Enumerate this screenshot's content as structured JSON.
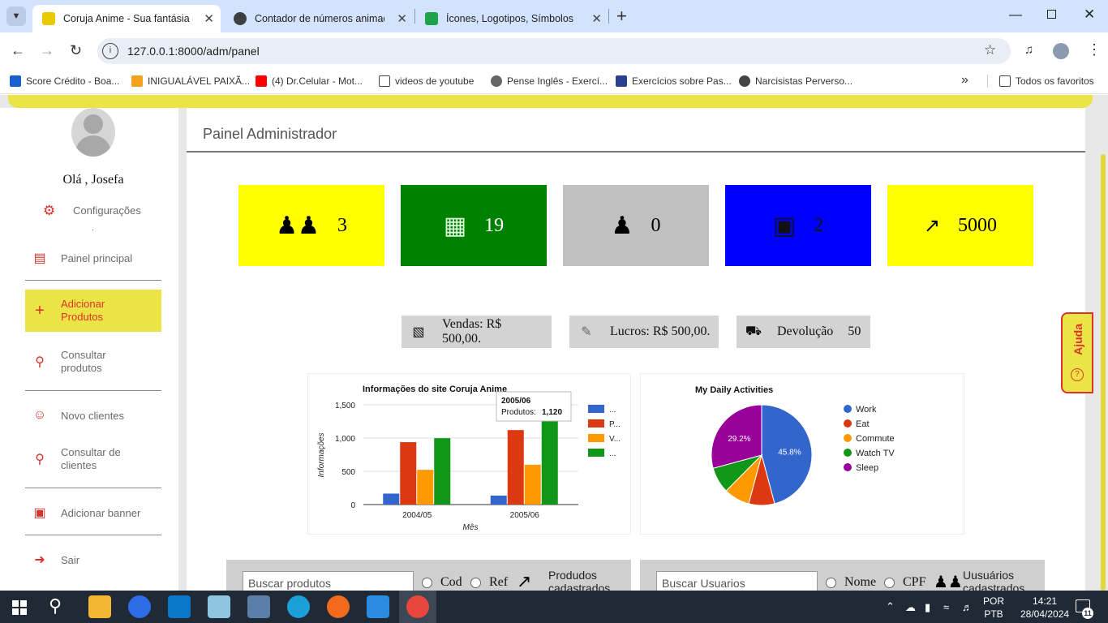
{
  "browser": {
    "tabs": [
      {
        "title": "Coruja Anime - Sua fantásia ide",
        "active": true
      },
      {
        "title": "Contador de números animado",
        "active": false
      },
      {
        "title": "Ícones, Logotipos, Símbolos de",
        "active": false
      }
    ],
    "url": "127.0.0.1:8000/adm/panel",
    "bookmarks": [
      "Score Crédito - Boa...",
      "INIGUALÁVEL PAIXÃ...",
      "(4) Dr.Celular - Mot...",
      "videos de youtube",
      "Pense Inglês - Exercí...",
      "Exercícios sobre Pas...",
      "Narcisistas Perverso..."
    ],
    "all_bookmarks": "Todos os favoritos"
  },
  "sidebar": {
    "greeting": "Olá , Josefa",
    "config": "Configurações",
    "dot": ".",
    "items": [
      {
        "label": "Painel principal",
        "icon": "table-icon"
      },
      {
        "label": "Adicionar Produtos",
        "icon": "plus-icon"
      },
      {
        "label": "Consultar produtos",
        "icon": "search-icon"
      },
      {
        "label": "Novo clientes",
        "icon": "user-icon"
      },
      {
        "label": "Consultar de clientes",
        "icon": "search-icon"
      },
      {
        "label": "Adicionar banner",
        "icon": "image-icon"
      },
      {
        "label": "Sair",
        "icon": "sign-out-icon"
      }
    ]
  },
  "main": {
    "title": "Painel Administrador",
    "stats": [
      {
        "value": "3",
        "color": "#ffff00",
        "icon": "users-icon"
      },
      {
        "value": "19",
        "color": "#008000",
        "icon": "box-icon"
      },
      {
        "value": "0",
        "color": "#c0c0c0",
        "icon": "user-alert-icon"
      },
      {
        "value": "2",
        "color": "#0000ff",
        "icon": "image-search-icon"
      },
      {
        "value": "5000",
        "color": "#ffff00",
        "icon": "growth-chart-icon"
      }
    ],
    "summary": [
      {
        "label": "Vendas: R$ 500,00.",
        "icon": "coins-icon"
      },
      {
        "label": "Lucros: R$ 500,00.",
        "icon": "money-hand-icon"
      },
      {
        "label": "Devolução",
        "value": "50",
        "icon": "cart-icon"
      }
    ],
    "search_products": {
      "placeholder": "Buscar produtos",
      "options": [
        "Cod",
        "Ref"
      ],
      "caption": "Produdos cadastrados"
    },
    "search_users": {
      "placeholder": "Buscar Usuarios",
      "options": [
        "Nome",
        "CPF"
      ],
      "caption": "Uusuários cadastrados"
    },
    "help": "Ajuda"
  },
  "chart_data": [
    {
      "type": "bar",
      "title": "Informações do site Coruja Anime",
      "xlabel": "Mês",
      "ylabel": "Informações",
      "categories": [
        "2004/05",
        "2005/06"
      ],
      "ylim": [
        0,
        1500
      ],
      "yticks": [
        "0",
        "500",
        "1,000",
        "1,500"
      ],
      "series": [
        {
          "name": "...",
          "color": "#3366cc",
          "values": [
            165,
            135
          ]
        },
        {
          "name": "P...",
          "color": "#dc3912",
          "values": [
            938,
            1120
          ]
        },
        {
          "name": "V...",
          "color": "#ff9900",
          "values": [
            522,
            599
          ]
        },
        {
          "name": "...",
          "color": "#109618",
          "values": [
            998,
            1268
          ]
        }
      ],
      "tooltip": {
        "title": "2005/06",
        "label": "Produtos:",
        "value": "1,120"
      }
    },
    {
      "type": "pie",
      "title": "My Daily Activities",
      "slices": [
        {
          "name": "Work",
          "value": 45.8,
          "color": "#3366cc",
          "label": "45.8%"
        },
        {
          "name": "Eat",
          "value": 8.3,
          "color": "#dc3912",
          "label": ""
        },
        {
          "name": "Commute",
          "value": 8.3,
          "color": "#ff9900",
          "label": ""
        },
        {
          "name": "Watch TV",
          "value": 8.3,
          "color": "#109618",
          "label": ""
        },
        {
          "name": "Sleep",
          "value": 29.2,
          "color": "#990099",
          "label": "29.2%"
        }
      ],
      "legend": "right"
    }
  ],
  "taskbar": {
    "lang1": "POR",
    "lang2": "PTB",
    "time": "14:21",
    "date": "28/04/2024",
    "notifications": "11"
  }
}
